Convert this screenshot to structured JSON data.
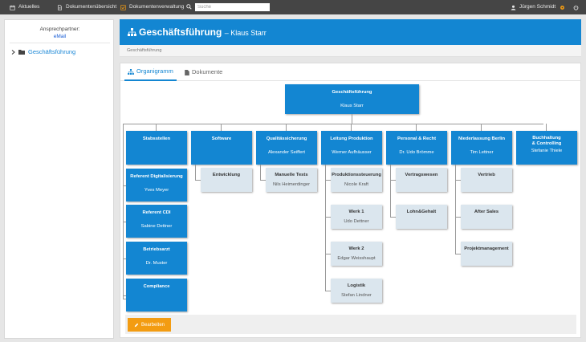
{
  "topbar": {
    "items": [
      {
        "label": "Aktuelles",
        "icon": "calendar-icon"
      },
      {
        "label": "Dokumentenübersicht",
        "icon": "document-icon"
      },
      {
        "label": "Dokumentenverwaltung",
        "icon": "checklist-icon"
      }
    ],
    "search_placeholder": "Suche",
    "user": "Jürgen Schmidt",
    "accent": "#f39c12"
  },
  "sidebar": {
    "label": "Ansprechpartner:",
    "contact": "eMail",
    "tree_item": "Geschäftsführung"
  },
  "header": {
    "title": "Geschäftsführung",
    "subtitle": "– Klaus Starr",
    "breadcrumb": "Geschäftsführung"
  },
  "tabs": [
    {
      "label": "Organigramm",
      "active": true
    },
    {
      "label": "Dokumente",
      "active": false
    }
  ],
  "org": {
    "root": {
      "title": "Geschäftsführung",
      "name": "Klaus Starr"
    },
    "departments": [
      {
        "title": "Stabsstellen",
        "name": ""
      },
      {
        "title": "Software",
        "name": ""
      },
      {
        "title": "Qualitässicherung",
        "name": "Alexander Seiffert"
      },
      {
        "title": "Leitung Produktion",
        "name": "Werner Aufhäusser"
      },
      {
        "title": "Personal & Recht",
        "name": "Dr. Udo Brömme"
      },
      {
        "title": "Niederlassung Berlin",
        "name": "Tim Lettner"
      },
      {
        "title": "Buchhaltung & Controlling",
        "name": "Stefanie Thiele"
      }
    ],
    "staff": [
      {
        "title": "Referent Digitalisierung",
        "name": "Yves Meyer"
      },
      {
        "title": "Referent CDI",
        "name": "Sabine Dettner"
      },
      {
        "title": "Betriebsarzt",
        "name": "Dr. Muster"
      },
      {
        "title": "Compliance",
        "name": ""
      }
    ],
    "software": [
      {
        "title": "Entwicklung",
        "name": ""
      }
    ],
    "quality": [
      {
        "title": "Manuelle Tests",
        "name": "Nils Heimerdinger"
      }
    ],
    "production": [
      {
        "title": "Produktionssteuerung",
        "name": "Nicole Kraft"
      },
      {
        "title": "Werk 1",
        "name": "Udo Dettner"
      },
      {
        "title": "Werk 2",
        "name": "Edgar Weisshaupt"
      },
      {
        "title": "Logistik",
        "name": "Stefan Lindner"
      }
    ],
    "personal": [
      {
        "title": "Vertragswesen",
        "name": ""
      },
      {
        "title": "Lohn&Gehalt",
        "name": ""
      }
    ],
    "berlin": [
      {
        "title": "Vertrieb",
        "name": ""
      },
      {
        "title": "After Sales",
        "name": ""
      },
      {
        "title": "Projektmanagement",
        "name": ""
      }
    ]
  },
  "edit_button": "Bearbeiten"
}
